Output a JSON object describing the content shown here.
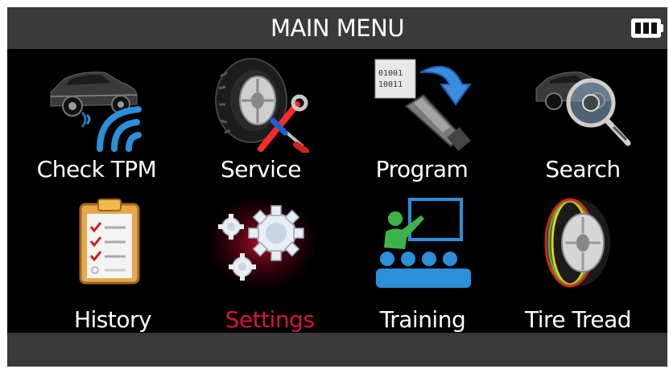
{
  "header": {
    "title": "MAIN MENU",
    "battery_icon": "battery-full-icon"
  },
  "menu": {
    "selected": "settings",
    "accent_color": "#d9123c",
    "items": [
      {
        "id": "check_tpm",
        "label": "Check  TPM",
        "icon": "car-sensor-signal-icon"
      },
      {
        "id": "service",
        "label": "Service",
        "icon": "tire-wrench-screwdriver-icon"
      },
      {
        "id": "program",
        "label": "Program",
        "icon": "binary-code-sensor-icon"
      },
      {
        "id": "search",
        "label": "Search",
        "icon": "car-magnifier-icon"
      },
      {
        "id": "history",
        "label": "History",
        "icon": "clipboard-checklist-icon"
      },
      {
        "id": "settings",
        "label": "Settings",
        "icon": "gears-icon"
      },
      {
        "id": "training",
        "label": "Training",
        "icon": "classroom-presentation-icon"
      },
      {
        "id": "tire_tread",
        "label": "Tire Tread",
        "icon": "tire-tread-icon"
      }
    ]
  },
  "icon_text": {
    "program_binary_1": "01001",
    "program_binary_2": "10011"
  }
}
